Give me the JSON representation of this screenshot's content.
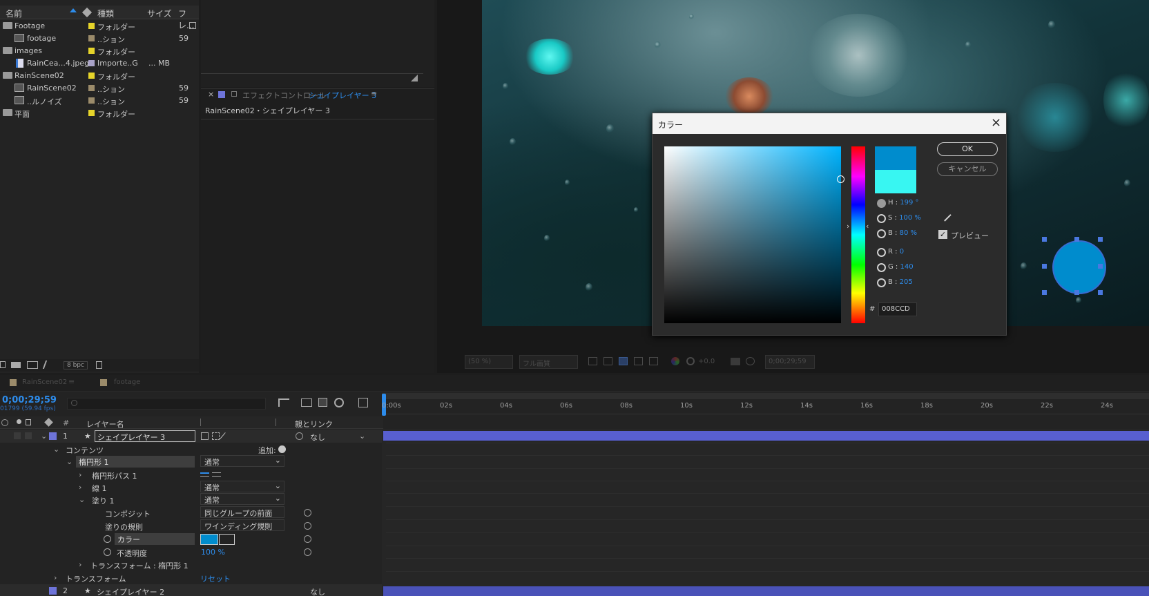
{
  "project": {
    "header": {
      "name": "名前",
      "type": "種類",
      "size": "サイズ",
      "frame": "フレ..."
    },
    "items": [
      {
        "kind": "folder",
        "name": "Footage",
        "type": "フォルダー",
        "size": "",
        "frame": "",
        "label_color": "#e6d42a"
      },
      {
        "kind": "comp",
        "name": "footage",
        "type": "..ション",
        "size": "",
        "frame": "59",
        "label_color": "#9b8b6a"
      },
      {
        "kind": "folder",
        "name": "images",
        "type": "フォルダー",
        "size": "",
        "frame": "",
        "label_color": "#e6d42a"
      },
      {
        "kind": "jpeg",
        "name": "RainCea...4.jpeg",
        "type": "Importe..G",
        "size": "... MB",
        "frame": "",
        "label_color": "#a9a3c8"
      },
      {
        "kind": "folder",
        "name": "RainScene02",
        "type": "フォルダー",
        "size": "",
        "frame": "",
        "label_color": "#e6d42a"
      },
      {
        "kind": "comp",
        "name": "RainScene02",
        "type": "..ション",
        "size": "",
        "frame": "59",
        "label_color": "#9b8b6a"
      },
      {
        "kind": "comp",
        "name": "..ルノイズ",
        "type": "..ション",
        "size": "",
        "frame": "59",
        "label_color": "#9b8b6a"
      },
      {
        "kind": "folder",
        "name": "平面",
        "type": "フォルダー",
        "size": "",
        "frame": "",
        "label_color": "#e6d42a"
      }
    ],
    "footer_bpc": "8 bpc"
  },
  "effects": {
    "tab_label": "エフェクトコントロール",
    "tab_layer": "シェイプレイヤー 3",
    "breadcrumb": "RainScene02・シェイプレイヤー 3"
  },
  "viewer": {
    "zoom": "(50 %)",
    "quality": "フル画質",
    "exposure": "+0.0",
    "timecode": "0;00;29;59"
  },
  "dialog": {
    "title": "カラー",
    "ok": "OK",
    "cancel": "キャンセル",
    "preview_label": "プレビュー",
    "h": {
      "label": "H",
      "value": "199",
      "unit": "°"
    },
    "s": {
      "label": "S",
      "value": "100",
      "unit": "%"
    },
    "b": {
      "label": "B",
      "value": "80",
      "unit": "%"
    },
    "r": {
      "label": "R",
      "value": "0"
    },
    "g": {
      "label": "G",
      "value": "140"
    },
    "bl": {
      "label": "B",
      "value": "205"
    },
    "hex_prefix": "#",
    "hex": "008CCD",
    "new_color": "#008ccd",
    "old_color": "#38f6f2"
  },
  "timeline": {
    "tab_comp": "RainScene02",
    "tab_footage": "footage",
    "timecode": "0;00;29;59",
    "frame_info": "01799 (59.94 fps)",
    "col_layer_name": "レイヤー名",
    "col_parent": "親とリンク",
    "col_num": "#",
    "ruler": [
      "0:00s",
      "02s",
      "04s",
      "06s",
      "08s",
      "10s",
      "12s",
      "14s",
      "16s",
      "18s",
      "20s",
      "22s",
      "24s"
    ],
    "layer1": {
      "num": "1",
      "name": "シェイプレイヤー 3",
      "parent": "なし"
    },
    "contents_label": "コンテンツ",
    "add_label": "追加:",
    "ellipse_label": "楕円形 1",
    "ellipse_mode": "通常",
    "ellipse_path_label": "楕円形パス 1",
    "stroke_label": "線 1",
    "stroke_mode": "通常",
    "fill_label": "塗り 1",
    "fill_mode": "通常",
    "composite_label": "コンポジット",
    "composite_value": "同じグループの前面",
    "fill_rule_label": "塗りの規則",
    "fill_rule_value": "ワインディング規則",
    "color_label": "カラー",
    "opacity_label": "不透明度",
    "opacity_value": "100 %",
    "transform_ellipse_label": "トランスフォーム : 楕円形 1",
    "transform_label": "トランスフォーム",
    "reset_label": "リセット",
    "layer2": {
      "num": "2",
      "name": "シェイプレイヤー 2",
      "parent": "なし"
    }
  }
}
